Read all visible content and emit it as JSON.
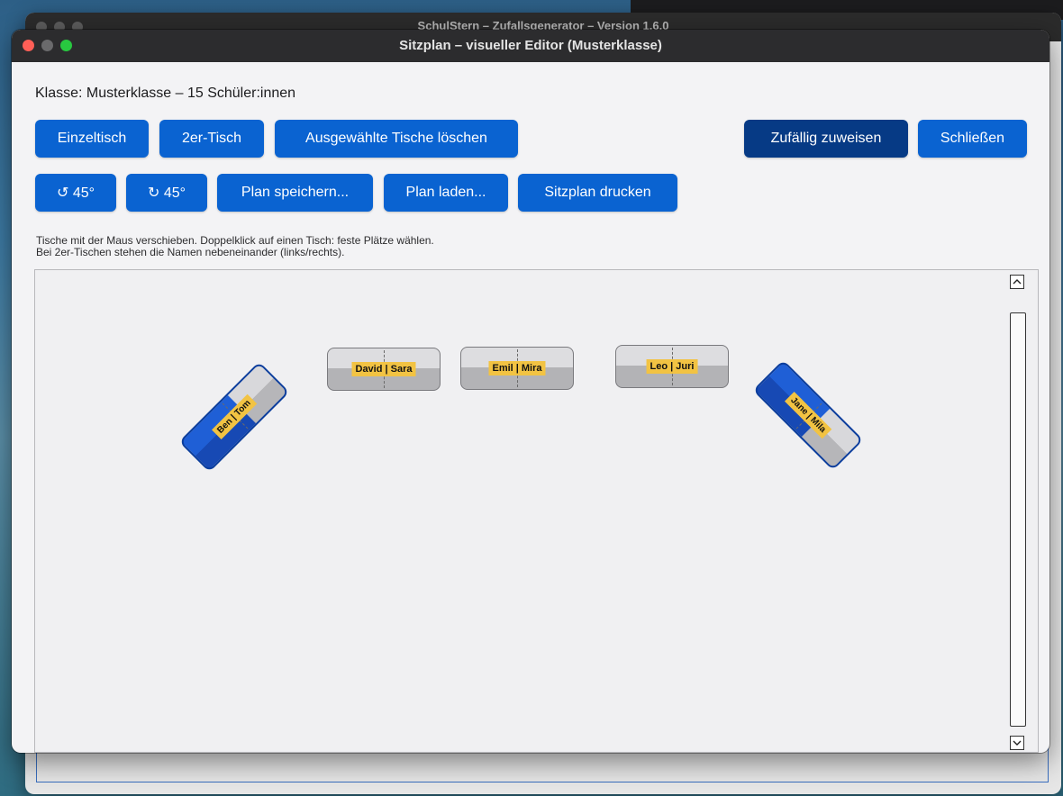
{
  "background_window": {
    "title": "SchulStern – Zufallsgenerator – Version 1.6.0"
  },
  "window": {
    "title": "Sitzplan – visueller Editor (Musterklasse)"
  },
  "class_info": "Klasse: Musterklasse – 15 Schüler:innen",
  "toolbar_row1": {
    "single_desk": "Einzeltisch",
    "double_desk": "2er-Tisch",
    "delete_selected": "Ausgewählte Tische löschen",
    "random_assign": "Zufällig zuweisen",
    "close": "Schließen"
  },
  "toolbar_row2": {
    "rotate_left": "↺ 45°",
    "rotate_right": "↻ 45°",
    "save_plan": "Plan speichern...",
    "load_plan": "Plan laden...",
    "print_plan": "Sitzplan drucken"
  },
  "hint": {
    "line1": "Tische mit der Maus verschieben. Doppelklick auf einen Tisch: feste Plätze wählen.",
    "line2": "Bei 2er-Tischen stehen die Namen nebeneinander (links/rechts)."
  },
  "desks": [
    {
      "names": "Ben | Tom",
      "rotation_deg": -45,
      "selected": true
    },
    {
      "names": "David | Sara",
      "rotation_deg": 0,
      "selected": false
    },
    {
      "names": "Emil | Mira",
      "rotation_deg": 0,
      "selected": false
    },
    {
      "names": "Leo | Juri",
      "rotation_deg": 0,
      "selected": false
    },
    {
      "names": "Jane | Mila",
      "rotation_deg": 45,
      "selected": true
    }
  ],
  "colors": {
    "button_blue": "#0a63d1",
    "button_dark": "#063a85",
    "name_tag": "#f2c343",
    "selected_desk": "#1f5fd6"
  }
}
